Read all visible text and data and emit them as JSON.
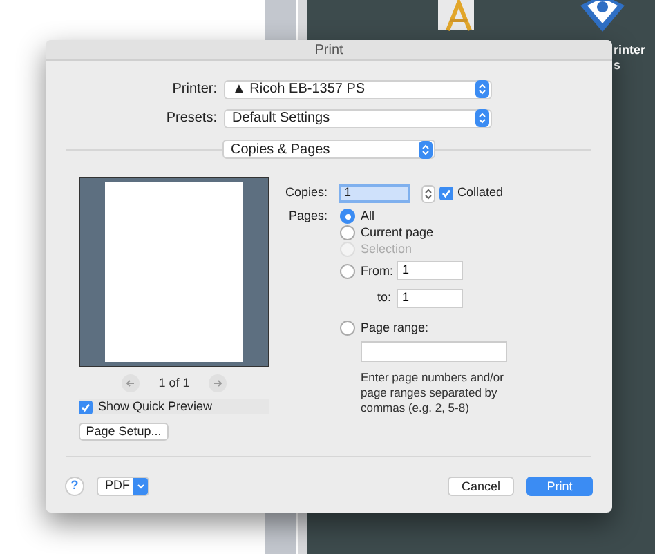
{
  "desktop": {
    "icon_label_lines": [
      "rinter",
      "s"
    ]
  },
  "window": {
    "title": "Print"
  },
  "printer": {
    "label": "Printer:",
    "warning": "▲",
    "value": "Ricoh EB-1357 PS"
  },
  "presets": {
    "label": "Presets:",
    "value": "Default Settings"
  },
  "section": {
    "value": "Copies & Pages"
  },
  "preview": {
    "page_counter": "1 of 1",
    "show_quick_preview": {
      "label": "Show Quick Preview",
      "checked": true
    }
  },
  "page_setup_button": "Page Setup...",
  "copies": {
    "label": "Copies:",
    "value": "1",
    "collated": {
      "label": "Collated",
      "checked": true
    }
  },
  "pages": {
    "label": "Pages:",
    "options": [
      {
        "kind": "plain",
        "label": "All",
        "selected": true,
        "disabled": false
      },
      {
        "kind": "plain",
        "label": "Current page",
        "selected": false,
        "disabled": false
      },
      {
        "kind": "plain",
        "label": "Selection",
        "selected": false,
        "disabled": true
      },
      {
        "kind": "from",
        "label": "From:",
        "selected": false,
        "disabled": false,
        "value": "1",
        "to_label": "to:",
        "to_value": "1"
      },
      {
        "kind": "range",
        "label": "Page range:",
        "selected": false,
        "disabled": false,
        "hint": "Enter page numbers and/or page ranges separated by commas (e.g. 2, 5-8)"
      }
    ]
  },
  "footer": {
    "help": "?",
    "pdf": "PDF",
    "cancel": "Cancel",
    "print": "Print"
  }
}
